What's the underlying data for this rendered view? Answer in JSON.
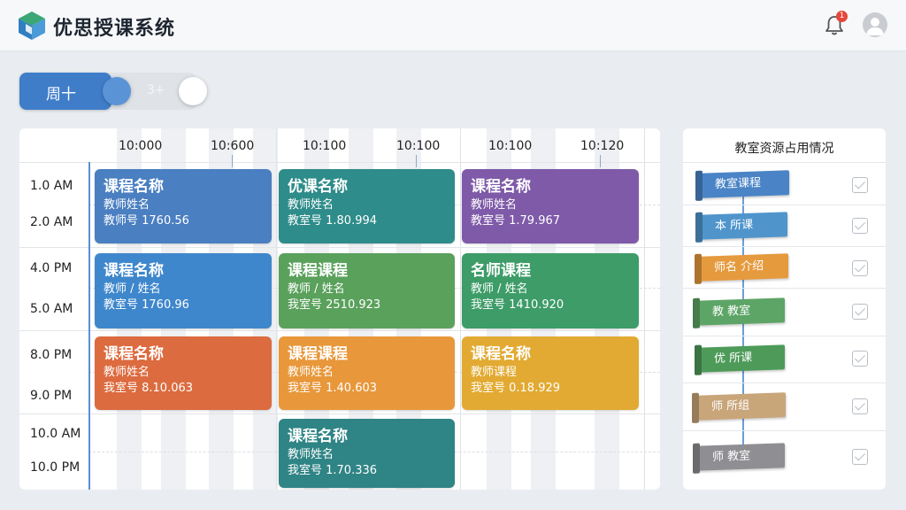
{
  "app": {
    "title": "优思授课系统",
    "logo_icon": "cube-icon"
  },
  "header": {
    "notification_count": "1",
    "bell_icon": "bell-icon",
    "avatar_icon": "user-icon"
  },
  "view_toggle": {
    "active_label": "周十",
    "inactive_label": "3+"
  },
  "schedule": {
    "columns": [
      "10:000",
      "10:600",
      "10:100",
      "10:100",
      "10:100",
      "10:120"
    ],
    "time_labels": [
      "1.0 AM",
      "2.0 AM",
      "4.0 PM",
      "5.0 AM",
      "8.0 PM",
      "9.0 PM",
      "10.0 AM",
      "10.0 PM"
    ],
    "cards": [
      {
        "title": "课程名称",
        "teacher": "教师姓名",
        "room": "教师号 1760.56",
        "color": "#4a7fc1"
      },
      {
        "title": "优课名称",
        "teacher": "教师姓名",
        "room": "教室号 1.80.994",
        "color": "#2e8c8a"
      },
      {
        "title": "课程名称",
        "teacher": "教师姓名",
        "room": "教室号 1.79.967",
        "color": "#7e5aa8"
      },
      {
        "title": "课程名称",
        "teacher": "教师 / 姓名",
        "room": "教室号 1760.96",
        "color": "#3f87cc"
      },
      {
        "title": "课程课程",
        "teacher": "教师 / 姓名",
        "room": "我室号 2510.923",
        "color": "#5aa15c"
      },
      {
        "title": "名师课程",
        "teacher": "教师 / 姓名",
        "room": "我室号 1410.920",
        "color": "#3d9c68"
      },
      {
        "title": "课程名称",
        "teacher": "教师姓名",
        "room": "我室号 8.10.063",
        "color": "#dc6b3f"
      },
      {
        "title": "课程课程",
        "teacher": "教师姓名",
        "room": "我室号 1.40.603",
        "color": "#e8973a"
      },
      {
        "title": "课程名称",
        "teacher": "教师课程",
        "room": "我室号 0.18.929",
        "color": "#e2aa32"
      },
      {
        "title": "课程名称",
        "teacher": "教师姓名",
        "room": "我室号 1.70.336",
        "color": "#2f8485"
      }
    ]
  },
  "resources": {
    "title": "教室资源占用情况",
    "items": [
      {
        "label": "教室课程",
        "color": "#4a84c6",
        "checked": true
      },
      {
        "label": "本 所课",
        "color": "#4f95cc",
        "checked": true
      },
      {
        "label": "师名 介绍",
        "color": "#e59a3e",
        "checked": true
      },
      {
        "label": "教 教室",
        "color": "#5da566",
        "checked": true
      },
      {
        "label": "优 所课",
        "color": "#4e9b59",
        "checked": true
      },
      {
        "label": "师 所组",
        "color": "#c9a57a",
        "checked": true
      },
      {
        "label": "师 教室",
        "color": "#8f8f93",
        "checked": true
      }
    ]
  }
}
